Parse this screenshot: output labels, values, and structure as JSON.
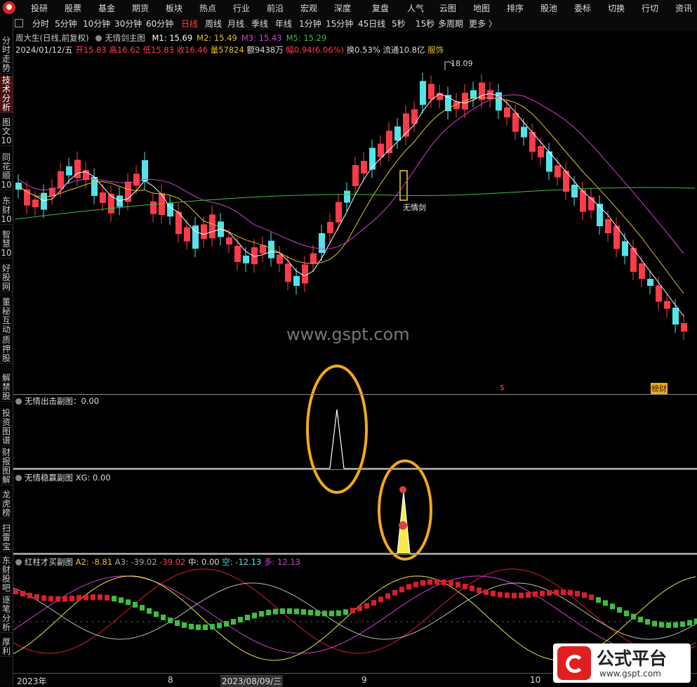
{
  "top_nav": [
    "投研",
    "股票",
    "基金",
    "期货",
    "板块",
    "热点",
    "行业",
    "前沿",
    "宏观",
    "深度",
    "复盘",
    "人气",
    "云图",
    "地图",
    "排序",
    "股池",
    "委标",
    "切换",
    "行切",
    "资讯"
  ],
  "period_bar": {
    "items": [
      "分时",
      "5分钟",
      "10分钟",
      "30分钟",
      "60分钟",
      "日线",
      "周线",
      "月线",
      "季线",
      "年线",
      "1分钟",
      "15分钟",
      "45日线",
      "5秒",
      "15秒",
      "多周期",
      "更多 〉"
    ],
    "active": "日线"
  },
  "sidebar": [
    "分时走势",
    "技术分析",
    "图文10",
    "同花顺10",
    "东财10",
    "智慧10",
    "好股网",
    "董秘互动",
    "质押股",
    "解禁股",
    "投资图谱",
    "财报图解",
    "龙虎榜",
    "扫雷宝",
    "东财股吧",
    "逐笔分析",
    "厚利"
  ],
  "main_panel": {
    "stock_label": "周大生(日线,前复权)",
    "indicator_name": "无情剑主图",
    "ma": [
      {
        "label": "M1: 15.69",
        "color": "#ffffff"
      },
      {
        "label": "M2: 15.49",
        "color": "#e6c229"
      },
      {
        "label": "M3: 15.43",
        "color": "#d43fd4"
      },
      {
        "label": "M5: 15.29",
        "color": "#3fbf3f"
      }
    ],
    "date": "2024/01/12/五",
    "open": "开15.83",
    "high": "高16.62",
    "low": "低15.83",
    "close": "收16.46",
    "volume": "量57824",
    "amount": "额9438万",
    "range": "幅0.94(6.06%)",
    "turnover": "换0.53%",
    "float": "流通10.8亿",
    "sector": "服饰",
    "peak_label": "18.09",
    "signal_label": "无情剑",
    "bottom_marks": [
      "$",
      "榜财"
    ]
  },
  "watermark": "www.gspt.com",
  "panel2": {
    "title": "无情出击副图：0.00"
  },
  "panel3": {
    "title": "无情稳赢副图",
    "xg": "XG: 0.00"
  },
  "panel4": {
    "title": "红柱才买副图",
    "a2": "A2: -8.81",
    "a3": "A3: -39.02",
    "a3b": "-39.02",
    "mid": "中: 0.00",
    "kong": "空: -12.13",
    "duo": "多: 12.13"
  },
  "x_axis": [
    "2023年",
    "8",
    "2023/08/09/三",
    "9",
    "10"
  ],
  "badge": {
    "title": "公式平台",
    "url": "www.gspt.com"
  },
  "colors": {
    "up": "#ff3b4a",
    "down": "#54e3ea",
    "ma1": "#ffffff",
    "ma2": "#e6c229",
    "ma3": "#d43fd4",
    "ma5": "#3fbf3f",
    "highlight": "#f2a91d"
  }
}
